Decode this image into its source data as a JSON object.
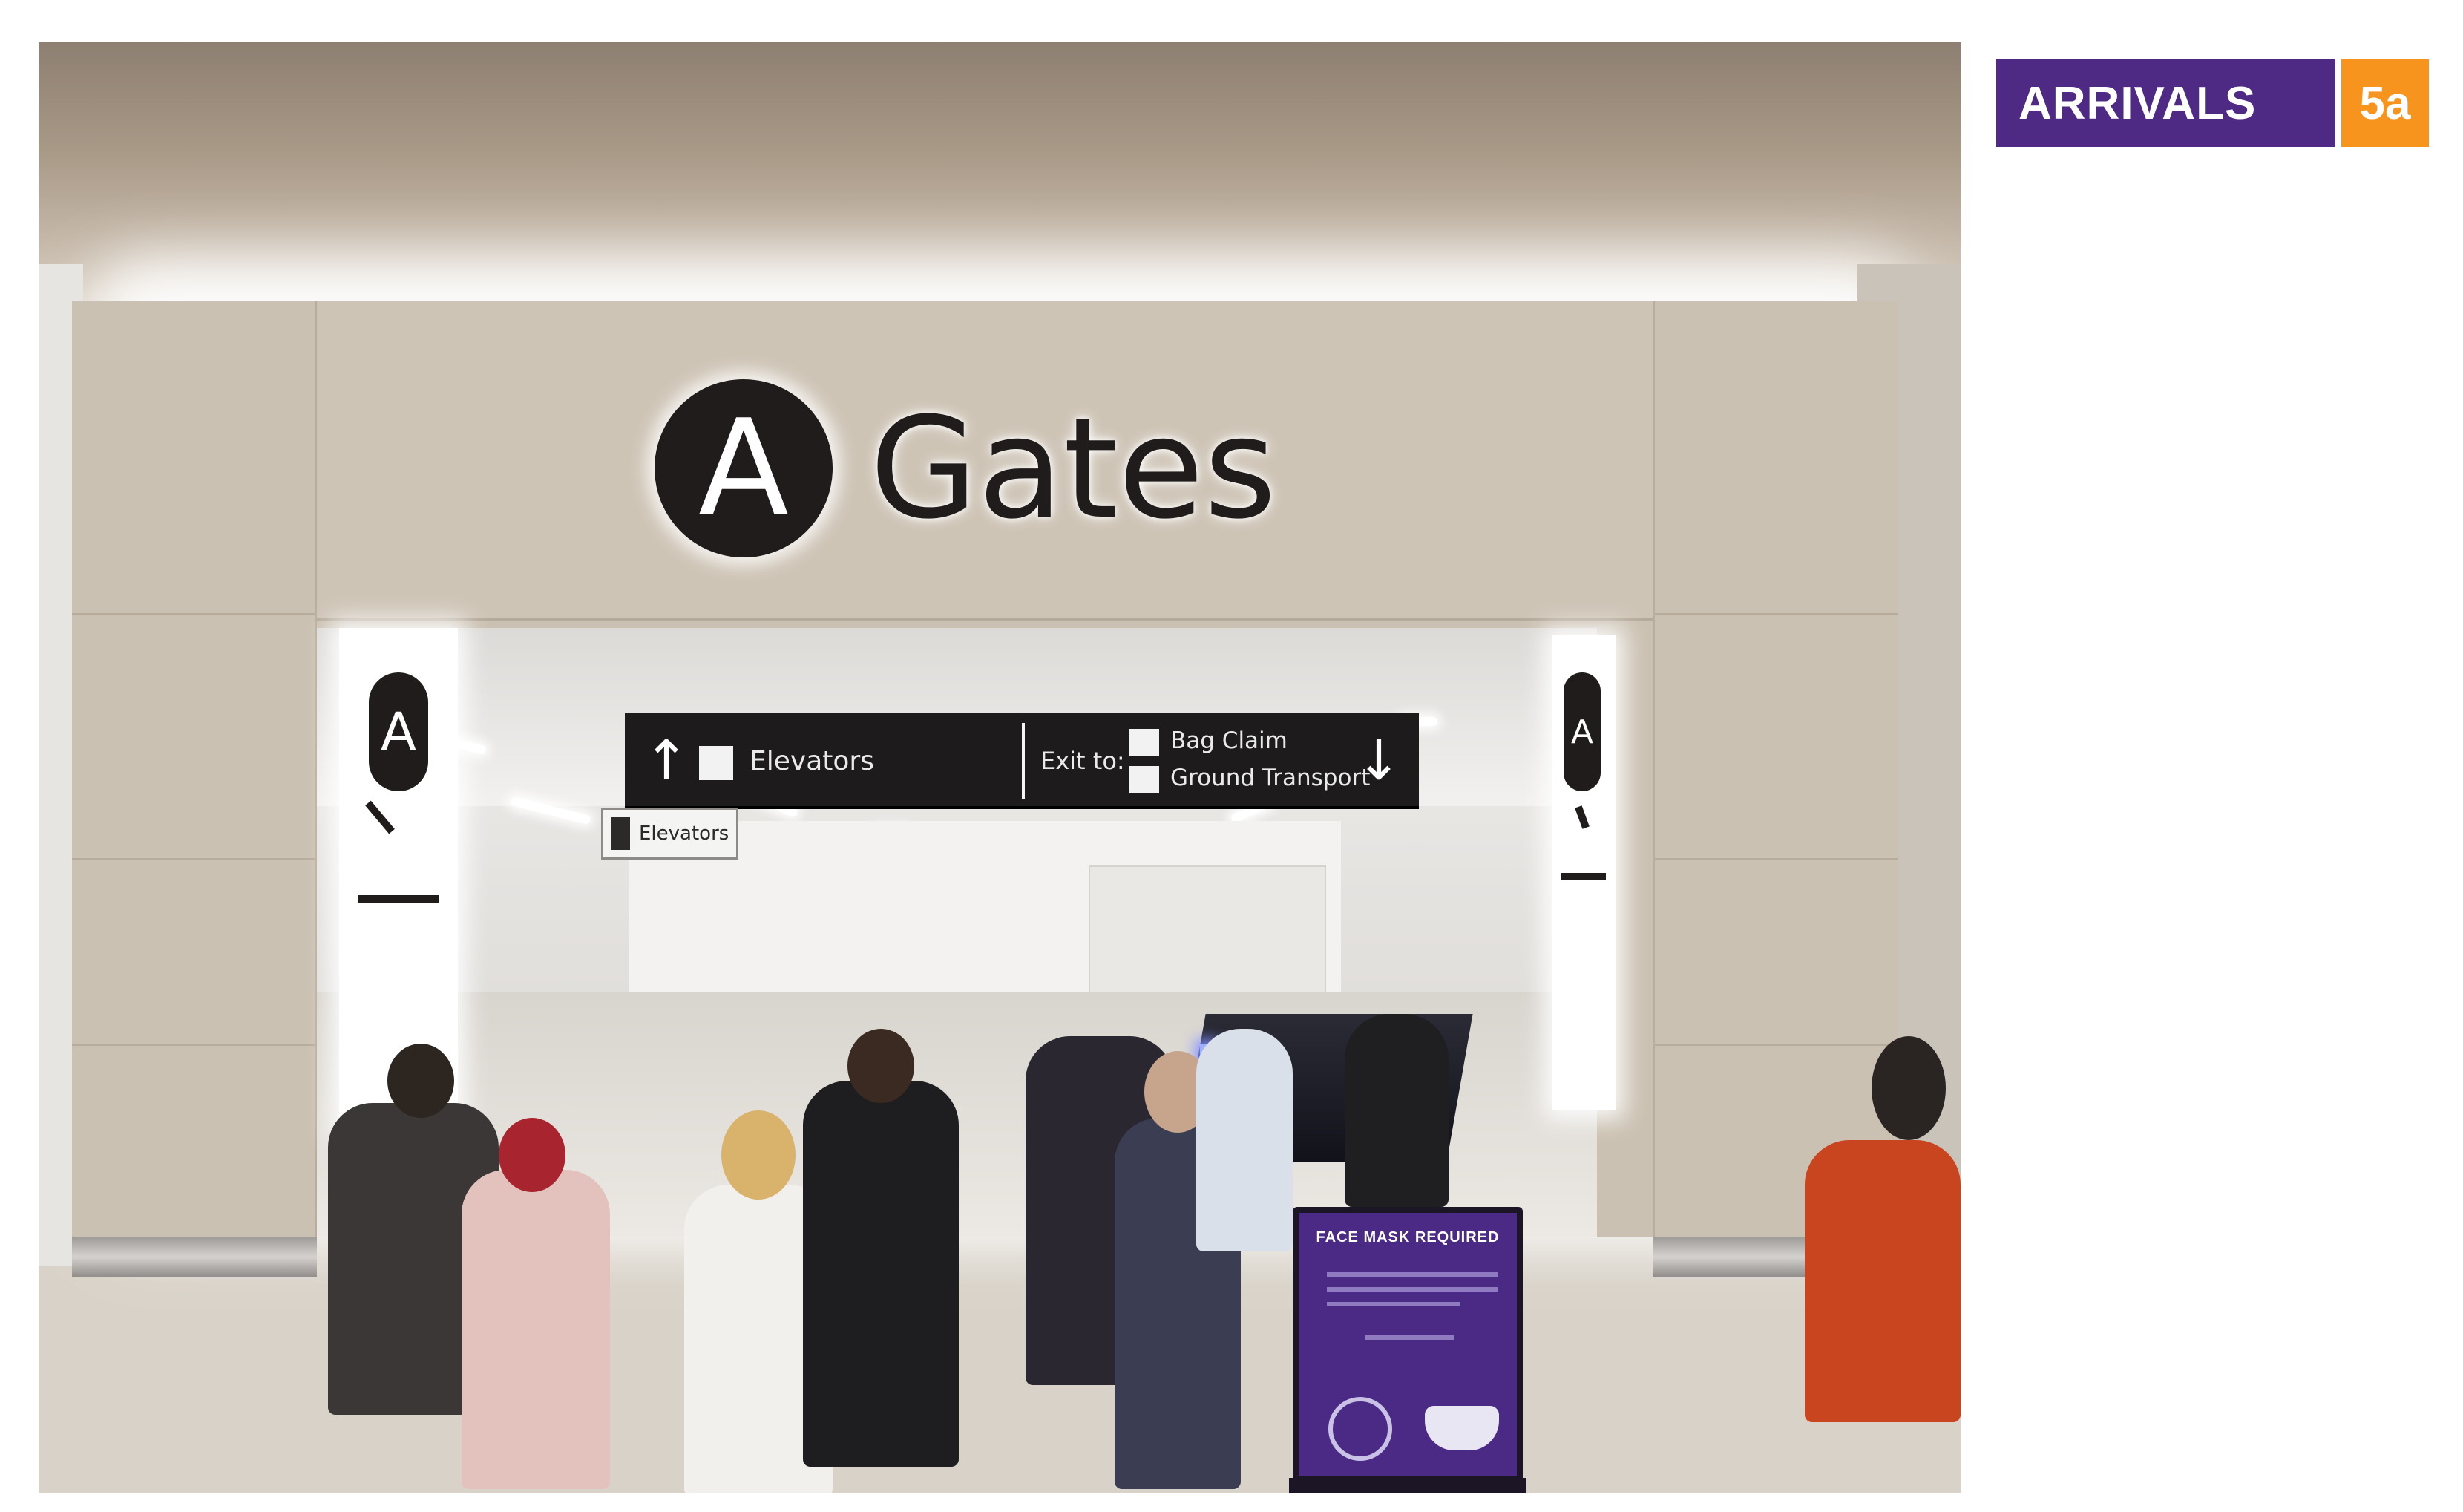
{
  "section": {
    "label": "ARRIVALS",
    "number": "5a",
    "label_color": "#4e2a84",
    "number_color": "#f7941d"
  },
  "portal_sign": {
    "badge_letter": "A",
    "title": "Gates"
  },
  "direction_sign": {
    "left_arrow": "↑",
    "left_label": "Elevators",
    "exit_label": "Exit to:",
    "destinations": [
      "Bag Claim",
      "Ground Transport"
    ],
    "right_arrow": "↓"
  },
  "elevator_sign": {
    "label": "Elevators"
  },
  "side_panels": {
    "badge_letter": "A"
  },
  "mask_sign": {
    "title": "FACE MASK REQUIRED"
  }
}
